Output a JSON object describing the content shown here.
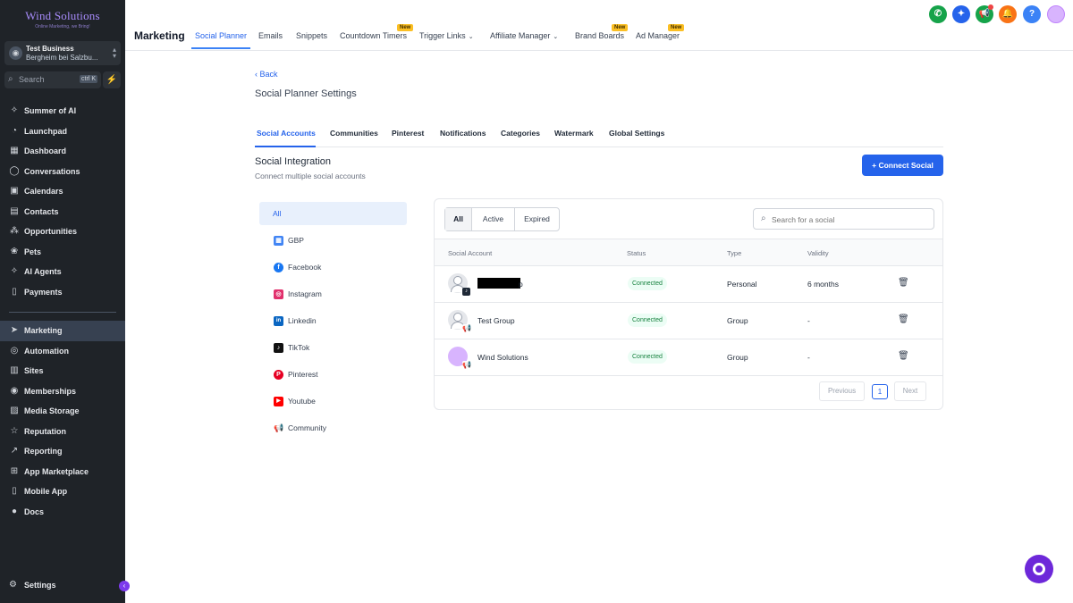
{
  "sidebar": {
    "logo_text": "Wind Solutions",
    "logo_tagline": "Online Marketing, we Bring!",
    "account_name": "Test Business",
    "account_location": "Bergheim bei Salzbu...",
    "search_label": "Search",
    "search_shortcut": "ctrl K",
    "items": [
      {
        "label": "Summer of AI",
        "icon": "sparkles-icon"
      },
      {
        "label": "Launchpad",
        "icon": "rocket-icon"
      },
      {
        "label": "Dashboard",
        "icon": "grid-icon"
      },
      {
        "label": "Conversations",
        "icon": "chat-icon"
      },
      {
        "label": "Calendars",
        "icon": "calendar-icon"
      },
      {
        "label": "Contacts",
        "icon": "contacts-icon"
      },
      {
        "label": "Opportunities",
        "icon": "opportunities-icon"
      },
      {
        "label": "Pets",
        "icon": "paw-icon"
      },
      {
        "label": "AI Agents",
        "icon": "ai-icon"
      },
      {
        "label": "Payments",
        "icon": "receipt-icon"
      }
    ],
    "items2": [
      {
        "label": "Marketing",
        "icon": "send-icon"
      },
      {
        "label": "Automation",
        "icon": "automation-icon"
      },
      {
        "label": "Sites",
        "icon": "globe-icon"
      },
      {
        "label": "Memberships",
        "icon": "award-icon"
      },
      {
        "label": "Media Storage",
        "icon": "image-icon"
      },
      {
        "label": "Reputation",
        "icon": "star-icon"
      },
      {
        "label": "Reporting",
        "icon": "chart-icon"
      },
      {
        "label": "App Marketplace",
        "icon": "apps-icon"
      },
      {
        "label": "Mobile App",
        "icon": "phone-icon"
      },
      {
        "label": "Docs",
        "icon": "info-icon"
      }
    ],
    "settings_label": "Settings"
  },
  "topbar": {
    "title": "Marketing",
    "tabs": [
      {
        "label": "Social Planner",
        "active": true
      },
      {
        "label": "Emails"
      },
      {
        "label": "Snippets"
      },
      {
        "label": "Countdown Timers",
        "badge": "New"
      },
      {
        "label": "Trigger Links"
      },
      {
        "label": "Affiliate Manager"
      },
      {
        "label": "Brand Boards",
        "badge": "New"
      },
      {
        "label": "Ad Manager",
        "badge": "New"
      }
    ],
    "icon_phone": "✆",
    "icon_magic": "✦",
    "icon_megaphone": "📢",
    "icon_bell": "🔔",
    "icon_help": "?",
    "colors": {
      "phone": "#16a34a",
      "magic": "#2563eb",
      "megaphone": "#16a34a",
      "bell": "#f97316",
      "help": "#3b82f6"
    }
  },
  "main": {
    "back_label": "Back",
    "page_title": "Social Planner Settings",
    "tabs": [
      "Social Accounts",
      "Communities",
      "Pinterest",
      "Notifications",
      "Categories",
      "Watermark",
      "Global Settings"
    ],
    "section_title": "Social Integration",
    "section_subtitle": "Connect multiple social accounts",
    "connect_button": "Connect Social",
    "connect_plus": "+",
    "filters": [
      {
        "label": "All"
      },
      {
        "label": "GBP",
        "icon": "gbp-icon",
        "glyph": "▦",
        "color": "#4285f4"
      },
      {
        "label": "Facebook",
        "icon": "facebook-icon",
        "glyph": "f",
        "color": "#1877f2"
      },
      {
        "label": "Instagram",
        "icon": "instagram-icon",
        "glyph": "◎",
        "color": "#e1306c"
      },
      {
        "label": "Linkedin",
        "icon": "linkedin-icon",
        "glyph": "in",
        "color": "#0a66c2"
      },
      {
        "label": "TikTok",
        "icon": "tiktok-icon",
        "glyph": "♪",
        "color": "#111111"
      },
      {
        "label": "Pinterest",
        "icon": "pinterest-icon",
        "glyph": "P",
        "color": "#e60023"
      },
      {
        "label": "Youtube",
        "icon": "youtube-icon",
        "glyph": "▶",
        "color": "#ff0000"
      },
      {
        "label": "Community",
        "icon": "community-icon",
        "glyph": "📢",
        "color": "#ffffff"
      }
    ],
    "segments": [
      "All",
      "Active",
      "Expired"
    ],
    "search_placeholder": "Search for a social",
    "columns": [
      "Social Account",
      "Status",
      "Type",
      "Validity"
    ],
    "rows": [
      {
        "name_suffix": "p",
        "status": "Connected",
        "type": "Personal",
        "validity": "6 months",
        "sub_glyph": "♪",
        "redacted": true
      },
      {
        "name": "Test Group",
        "status": "Connected",
        "type": "Group",
        "validity": "-",
        "sub_glyph": "📢"
      },
      {
        "name": "Wind Solutions",
        "status": "Connected",
        "type": "Group",
        "validity": "-",
        "sub_glyph": "📢"
      }
    ],
    "pager": {
      "previous": "Previous",
      "page": "1",
      "next": "Next"
    },
    "trash_glyph": "🗑"
  }
}
